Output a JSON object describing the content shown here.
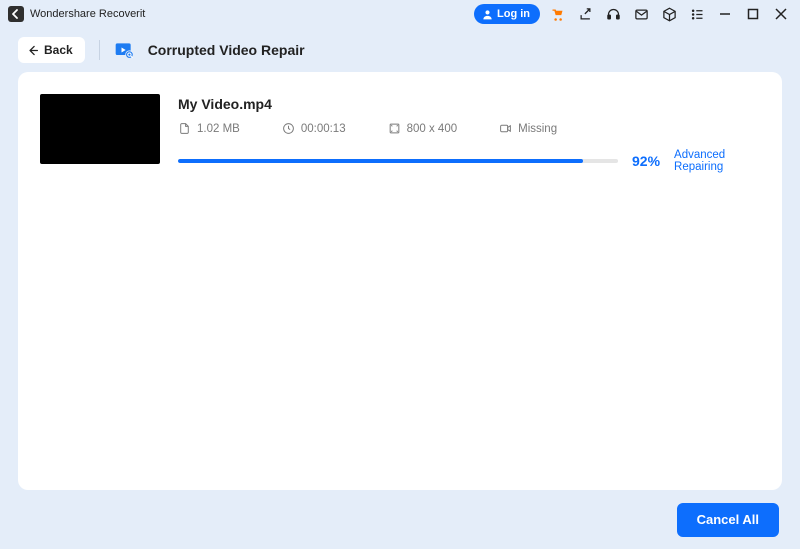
{
  "app": {
    "name": "Wondershare Recoverit",
    "login_label": "Log in"
  },
  "toolbar": {
    "back_label": "Back",
    "page_title": "Corrupted Video Repair"
  },
  "item": {
    "filename": "My Video.mp4",
    "size": "1.02  MB",
    "duration": "00:00:13",
    "dimensions": "800 x 400",
    "state": "Missing",
    "progress_pct": 92,
    "progress_label": "92%",
    "status": "Advanced Repairing"
  },
  "footer": {
    "cancel_all_label": "Cancel All"
  },
  "colors": {
    "accent": "#0D6EFD",
    "bg": "#E4EDF9",
    "cart": "#FF7A00"
  }
}
